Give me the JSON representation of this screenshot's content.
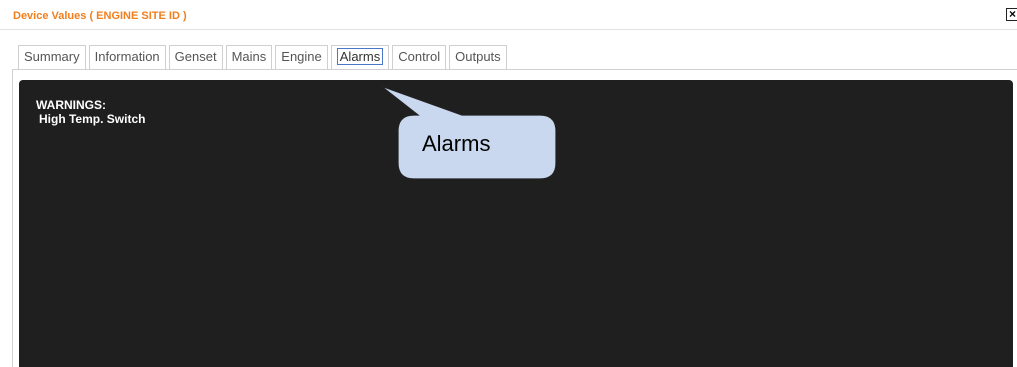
{
  "dialog": {
    "title": "Device Values ( ENGINE SITE ID )",
    "close_icon": "close-x-icon"
  },
  "tabs": [
    {
      "label": "Summary"
    },
    {
      "label": "Information"
    },
    {
      "label": "Genset"
    },
    {
      "label": "Mains"
    },
    {
      "label": "Engine"
    },
    {
      "label": "Alarms",
      "active": true
    },
    {
      "label": "Control"
    },
    {
      "label": "Outputs"
    }
  ],
  "alarms_panel": {
    "heading": "WARNINGS:",
    "items": [
      "High Temp. Switch"
    ]
  },
  "callout": {
    "label": "Alarms"
  },
  "colors": {
    "title": "#f07f1e",
    "panel_bg": "#1f1f1f",
    "callout_fill": "#c9d8ee",
    "active_tab_border": "#4a78c8"
  }
}
